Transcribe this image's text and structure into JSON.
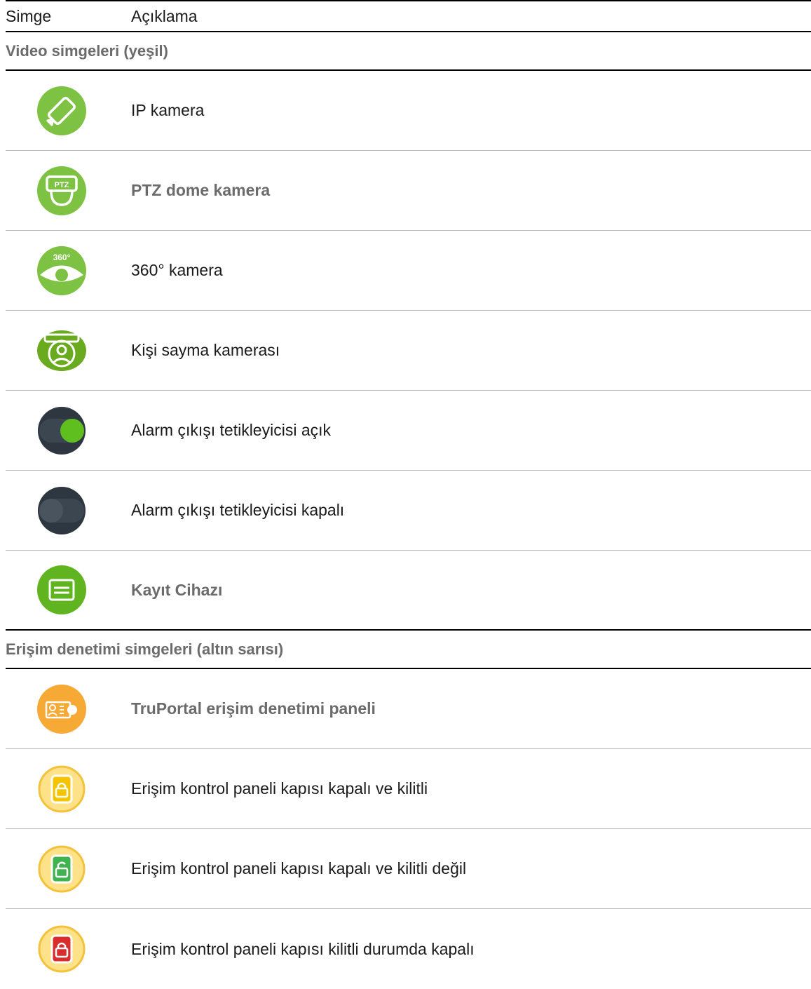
{
  "header": {
    "col1": "Simge",
    "col2": "Açıklama"
  },
  "sections": [
    {
      "title": "Video simgeleri (yeşil)",
      "rows": [
        {
          "icon": "ip-camera-icon",
          "text": "IP kamera",
          "bold": false
        },
        {
          "icon": "ptz-dome-camera-icon",
          "icon_text": "PTZ",
          "text": "PTZ dome kamera",
          "bold": true
        },
        {
          "icon": "360-camera-icon",
          "icon_text": "360°",
          "text": "360° kamera",
          "bold": false
        },
        {
          "icon": "people-counting-camera-icon",
          "text": "Kişi sayma kamerası",
          "bold": false
        },
        {
          "icon": "toggle-on-icon",
          "text": "Alarm çıkışı tetikleyicisi açık",
          "bold": false
        },
        {
          "icon": "toggle-off-icon",
          "text": "Alarm çıkışı tetikleyicisi kapalı",
          "bold": false
        },
        {
          "icon": "recorder-icon",
          "text": "Kayıt Cihazı",
          "bold": true
        }
      ]
    },
    {
      "title": "Erişim denetimi simgeleri (altın sarısı)",
      "rows": [
        {
          "icon": "access-panel-icon",
          "text": "TruPortal erişim denetimi paneli",
          "bold": true
        },
        {
          "icon": "door-locked-icon",
          "text": "Erişim kontrol paneli kapısı kapalı ve kilitli",
          "bold": false
        },
        {
          "icon": "door-unlocked-icon",
          "text": "Erişim kontrol paneli kapısı kapalı ve kilitli değil",
          "bold": false
        },
        {
          "icon": "door-closed-locked-red-icon",
          "text": "Erişim kontrol paneli kapısı kilitli durumda kapalı",
          "bold": false
        }
      ]
    }
  ],
  "colors": {
    "video_green": "#7dc242",
    "toggle_dark": "#2e3640",
    "access_orange": "#f7a935",
    "door_yellow": "#f5c400",
    "door_green": "#3fb34f",
    "door_red": "#d92d2d"
  }
}
